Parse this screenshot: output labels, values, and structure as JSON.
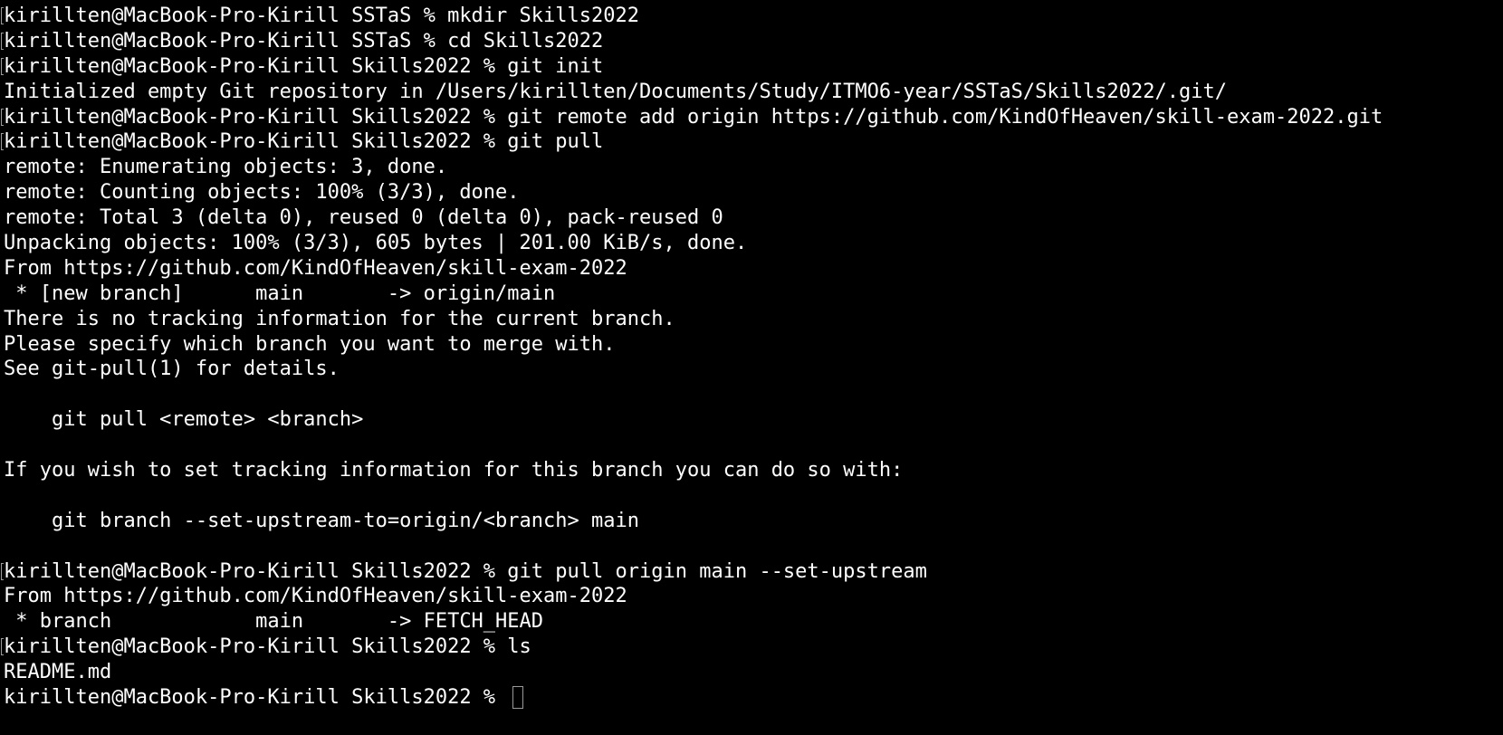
{
  "terminal": {
    "colors": {
      "background": "#000000",
      "foreground": "#ffffff",
      "cursor": "#9a9a9a"
    },
    "lines": [
      {
        "type": "prompt",
        "text": "kirillten@MacBook-Pro-Kirill SSTaS % mkdir Skills2022"
      },
      {
        "type": "prompt",
        "text": "kirillten@MacBook-Pro-Kirill SSTaS % cd Skills2022"
      },
      {
        "type": "prompt",
        "text": "kirillten@MacBook-Pro-Kirill Skills2022 % git init"
      },
      {
        "type": "output",
        "text": "Initialized empty Git repository in /Users/kirillten/Documents/Study/ITMO6-year/SSTaS/Skills2022/.git/"
      },
      {
        "type": "prompt",
        "text": "kirillten@MacBook-Pro-Kirill Skills2022 % git remote add origin https://github.com/KindOfHeaven/skill-exam-2022.git"
      },
      {
        "type": "prompt",
        "text": "kirillten@MacBook-Pro-Kirill Skills2022 % git pull"
      },
      {
        "type": "output",
        "text": "remote: Enumerating objects: 3, done."
      },
      {
        "type": "output",
        "text": "remote: Counting objects: 100% (3/3), done."
      },
      {
        "type": "output",
        "text": "remote: Total 3 (delta 0), reused 0 (delta 0), pack-reused 0"
      },
      {
        "type": "output",
        "text": "Unpacking objects: 100% (3/3), 605 bytes | 201.00 KiB/s, done."
      },
      {
        "type": "output",
        "text": "From https://github.com/KindOfHeaven/skill-exam-2022"
      },
      {
        "type": "output",
        "text": " * [new branch]      main       -> origin/main"
      },
      {
        "type": "output",
        "text": "There is no tracking information for the current branch."
      },
      {
        "type": "output",
        "text": "Please specify which branch you want to merge with."
      },
      {
        "type": "output",
        "text": "See git-pull(1) for details."
      },
      {
        "type": "output",
        "text": ""
      },
      {
        "type": "output",
        "text": "    git pull <remote> <branch>"
      },
      {
        "type": "output",
        "text": ""
      },
      {
        "type": "output",
        "text": "If you wish to set tracking information for this branch you can do so with:"
      },
      {
        "type": "output",
        "text": ""
      },
      {
        "type": "output",
        "text": "    git branch --set-upstream-to=origin/<branch> main"
      },
      {
        "type": "output",
        "text": ""
      },
      {
        "type": "prompt",
        "text": "kirillten@MacBook-Pro-Kirill Skills2022 % git pull origin main --set-upstream"
      },
      {
        "type": "output",
        "text": "From https://github.com/KindOfHeaven/skill-exam-2022"
      },
      {
        "type": "output",
        "text": " * branch            main       -> FETCH_HEAD"
      },
      {
        "type": "prompt",
        "text": "kirillten@MacBook-Pro-Kirill Skills2022 % ls"
      },
      {
        "type": "output",
        "text": "README.md"
      },
      {
        "type": "current",
        "text": "kirillten@MacBook-Pro-Kirill Skills2022 % "
      }
    ]
  }
}
